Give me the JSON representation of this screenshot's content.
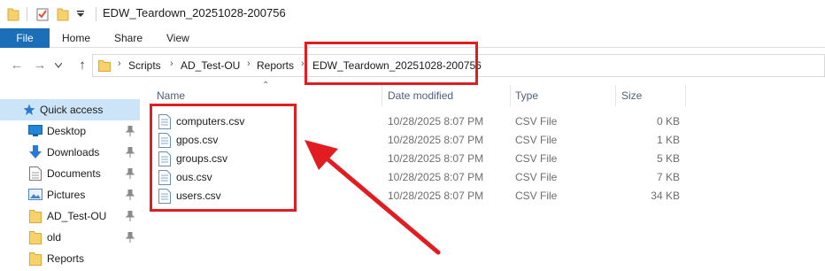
{
  "window": {
    "title": "EDW_Teardown_20251028-200756"
  },
  "ribbon": {
    "tabs": [
      "File",
      "Home",
      "Share",
      "View"
    ]
  },
  "address": {
    "path": [
      "Scripts",
      "AD_Test-OU",
      "Reports",
      "EDW_Teardown_20251028-200756"
    ]
  },
  "sidebar": {
    "items": [
      {
        "label": "Quick access",
        "icon": "star-icon",
        "active": true
      },
      {
        "label": "Desktop",
        "icon": "desktop-icon",
        "pinned": true
      },
      {
        "label": "Downloads",
        "icon": "download-icon",
        "pinned": true
      },
      {
        "label": "Documents",
        "icon": "documents-icon",
        "pinned": true
      },
      {
        "label": "Pictures",
        "icon": "pictures-icon",
        "pinned": true
      },
      {
        "label": "AD_Test-OU",
        "icon": "folder-icon",
        "pinned": true
      },
      {
        "label": "old",
        "icon": "folder-icon",
        "pinned": true
      },
      {
        "label": "Reports",
        "icon": "folder-icon",
        "pinned": false
      }
    ]
  },
  "filelist": {
    "columns": [
      "Name",
      "Date modified",
      "Type",
      "Size"
    ],
    "rows": [
      {
        "name": "computers.csv",
        "date": "10/28/2025 8:07 PM",
        "type": "CSV File",
        "size": "0 KB"
      },
      {
        "name": "gpos.csv",
        "date": "10/28/2025 8:07 PM",
        "type": "CSV File",
        "size": "1 KB"
      },
      {
        "name": "groups.csv",
        "date": "10/28/2025 8:07 PM",
        "type": "CSV File",
        "size": "5 KB"
      },
      {
        "name": "ous.csv",
        "date": "10/28/2025 8:07 PM",
        "type": "CSV File",
        "size": "7 KB"
      },
      {
        "name": "users.csv",
        "date": "10/28/2025 8:07 PM",
        "type": "CSV File",
        "size": "34 KB"
      }
    ]
  },
  "colors": {
    "accent": "#1a6fb8",
    "callout": "#e11d22",
    "selection": "#cce4f7",
    "folder": "#f7d26b"
  }
}
